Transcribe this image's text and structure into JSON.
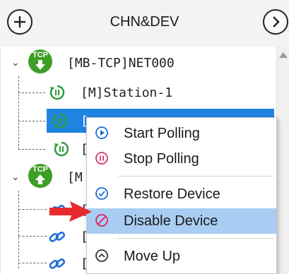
{
  "header": {
    "title": "CHN&DEV",
    "left_icon": "add-circle-icon",
    "right_icon": "chevron-right-circle-icon"
  },
  "tree": {
    "channel1": {
      "label": "[MB-TCP]NET000"
    },
    "station1": {
      "label": "[M]Station-1"
    },
    "partial": [
      "[",
      "[",
      "[M",
      "[",
      "[",
      "["
    ]
  },
  "menu": {
    "items": [
      {
        "label": "Start Polling",
        "icon": "play-circle-icon"
      },
      {
        "label": "Stop Polling",
        "icon": "pause-circle-icon"
      },
      {
        "label": "Restore Device",
        "icon": "check-circle-icon"
      },
      {
        "label": "Disable Device",
        "icon": "prohibit-icon"
      },
      {
        "label": "Move Up",
        "icon": "chevron-up-circle-icon"
      }
    ]
  },
  "colors": {
    "selection": "#1e84e0",
    "menu_highlight": "#a9cdf2",
    "tcp_green": "#3f9e26",
    "start_blue": "#1e6fd9",
    "stop_pink": "#d6336c",
    "disable_red": "#e0245e"
  }
}
